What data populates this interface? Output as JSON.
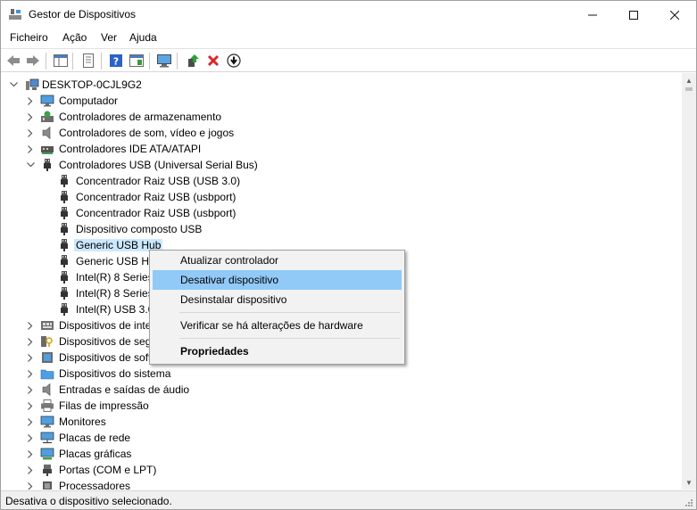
{
  "window": {
    "title": "Gestor de Dispositivos"
  },
  "menubar": {
    "items": [
      "Ficheiro",
      "Ação",
      "Ver",
      "Ajuda"
    ]
  },
  "tree": {
    "root": "DESKTOP-0CJL9G2",
    "items": [
      "Computador",
      "Controladores de armazenamento",
      "Controladores de som, vídeo e jogos",
      "Controladores IDE ATA/ATAPI",
      "Controladores USB (Universal Serial Bus)",
      "Concentrador Raiz USB (USB 3.0)",
      "Concentrador Raiz USB (usbport)",
      "Concentrador Raiz USB (usbport)",
      "Dispositivo composto USB",
      "Generic USB Hub",
      "Generic USB Hu",
      "Intel(R) 8 Series,",
      "Intel(R) 8 Series,",
      "Intel(R) USB 3.0",
      "Dispositivos de inte",
      "Dispositivos de seg",
      "Dispositivos de soft",
      "Dispositivos do sistema",
      "Entradas e saídas de áudio",
      "Filas de impressão",
      "Monitores",
      "Placas de rede",
      "Placas gráficas",
      "Portas (COM e LPT)",
      "Processadores"
    ]
  },
  "context_menu": {
    "items": [
      "Atualizar controlador",
      "Desativar dispositivo",
      "Desinstalar dispositivo",
      "Verificar se há alterações de hardware",
      "Propriedades"
    ]
  },
  "statusbar": {
    "text": "Desativa o dispositivo selecionado."
  },
  "colors": {
    "selection": "#cce8ff",
    "menu_highlight": "#91c9f7",
    "status_bg": "#f0f0f0"
  }
}
